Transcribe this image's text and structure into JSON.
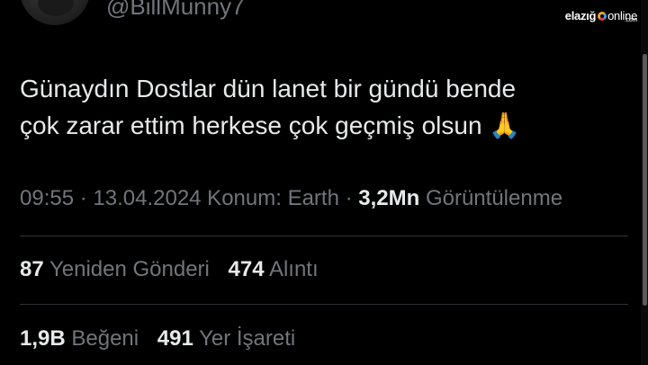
{
  "author": {
    "handle": "@BillMunny7"
  },
  "watermark": {
    "brand_a": "elazığ",
    "brand_b": "online",
    "brand_c": ".com"
  },
  "tweet": {
    "line1": "Günaydın Dostlar dün lanet bir gündü  bende",
    "line2": "çok zarar ettim herkese çok geçmiş olsun",
    "emoji": "🙏"
  },
  "meta": {
    "time": "09:55",
    "sep1": " · ",
    "date": "13.04.2024",
    "location": " Konum: Earth",
    "sep2": " · ",
    "views_count": "3,2Mn",
    "views_label": " Görüntülenme"
  },
  "stats_row1": {
    "reposts_count": "87",
    "reposts_label": "Yeniden Gönderi",
    "quotes_count": "474",
    "quotes_label": "Alıntı"
  },
  "stats_row2": {
    "likes_count": "1,9B",
    "likes_label": "Beğeni",
    "bookmarks_count": "491",
    "bookmarks_label": "Yer İşareti"
  },
  "icons": {
    "emoji": "folded-hands-icon",
    "logo": "elazig-online-logo"
  },
  "colors": {
    "background": "#000000",
    "text_primary": "#e7e9ea",
    "text_secondary": "#71767b",
    "divider": "#2f3336"
  }
}
